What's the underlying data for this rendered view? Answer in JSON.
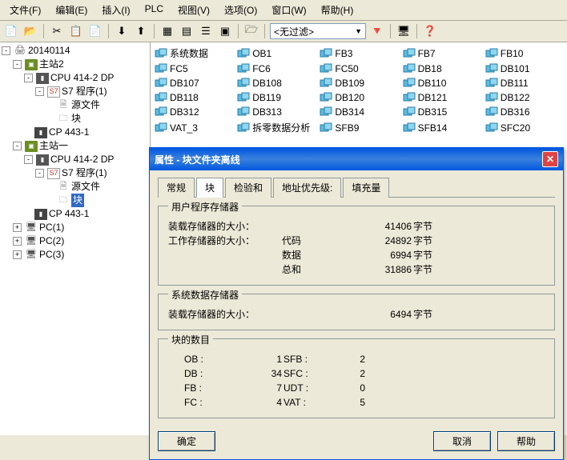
{
  "menu": [
    "文件(F)",
    "编辑(E)",
    "插入(I)",
    "PLC",
    "视图(V)",
    "选项(O)",
    "窗口(W)",
    "帮助(H)"
  ],
  "filter": "<无过滤>",
  "tree": {
    "project": "20140114",
    "nodes": [
      {
        "label": "主站2",
        "type": "station",
        "expanded": true,
        "children": [
          {
            "label": "CPU 414-2 DP",
            "type": "cpu",
            "expanded": true,
            "children": [
              {
                "label": "S7 程序(1)",
                "type": "s7",
                "expanded": true,
                "children": [
                  {
                    "label": "源文件",
                    "type": "src"
                  },
                  {
                    "label": "块",
                    "type": "blk"
                  }
                ]
              }
            ]
          },
          {
            "label": "CP 443-1",
            "type": "cp"
          }
        ]
      },
      {
        "label": "主站一",
        "type": "station",
        "expanded": true,
        "children": [
          {
            "label": "CPU 414-2 DP",
            "type": "cpu",
            "expanded": true,
            "children": [
              {
                "label": "S7 程序(1)",
                "type": "s7",
                "expanded": true,
                "children": [
                  {
                    "label": "源文件",
                    "type": "src"
                  },
                  {
                    "label": "块",
                    "type": "blk",
                    "selected": true
                  }
                ]
              }
            ]
          },
          {
            "label": "CP 443-1",
            "type": "cp"
          }
        ]
      },
      {
        "label": "PC(1)",
        "type": "pc"
      },
      {
        "label": "PC(2)",
        "type": "pc"
      },
      {
        "label": "PC(3)",
        "type": "pc"
      }
    ]
  },
  "grid": [
    "系统数据",
    "OB1",
    "FB3",
    "FB7",
    "FB10",
    "FC5",
    "FC6",
    "FC50",
    "DB18",
    "DB101",
    "DB107",
    "DB108",
    "DB109",
    "DB110",
    "DB111",
    "DB118",
    "DB119",
    "DB120",
    "DB121",
    "DB122",
    "DB312",
    "DB313",
    "DB314",
    "DB315",
    "DB316",
    "VAT_3",
    "拆零数据分析",
    "SFB9",
    "SFB14",
    "SFC20"
  ],
  "dialog": {
    "title": "属性 - 块文件夹离线",
    "tabs": [
      "常规",
      "块",
      "检验和",
      "地址优先级:",
      "填充量"
    ],
    "activeTab": 1,
    "sec1": {
      "title": "用户程序存储器",
      "loadLabel": "装载存储器的大小：",
      "loadVal": "41406",
      "unit": "字节",
      "workLabel": "工作存储器的大小：",
      "codeLabel": "代码",
      "codeVal": "24892",
      "dataLabel": "数据",
      "dataVal": "6994",
      "sumLabel": "总和",
      "sumVal": "31886"
    },
    "sec2": {
      "title": "系统数据存储器",
      "loadLabel": "装载存储器的大小：",
      "loadVal": "6494",
      "unit": "字节"
    },
    "sec3": {
      "title": "块的数目",
      "rows": [
        [
          "OB :",
          "1",
          "SFB :",
          "2"
        ],
        [
          "DB :",
          "34",
          "SFC :",
          "2"
        ],
        [
          "FB :",
          "7",
          "UDT :",
          "0"
        ],
        [
          "FC :",
          "4",
          "VAT :",
          "5"
        ]
      ]
    },
    "btns": {
      "ok": "确定",
      "cancel": "取消",
      "help": "帮助"
    }
  }
}
